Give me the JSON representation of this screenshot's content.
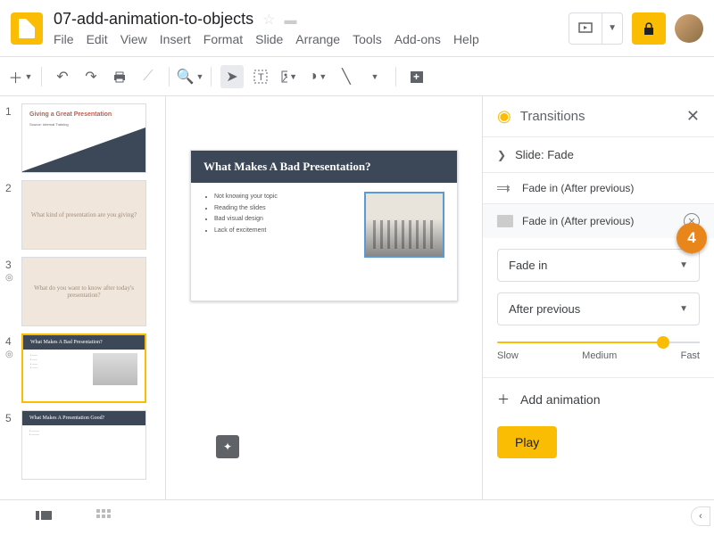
{
  "header": {
    "title": "07-add-animation-to-objects",
    "menu": [
      "File",
      "Edit",
      "View",
      "Insert",
      "Format",
      "Slide",
      "Arrange",
      "Tools",
      "Add-ons",
      "Help"
    ]
  },
  "filmstrip": {
    "slides": [
      {
        "num": "1",
        "title": "Giving a Great Presentation",
        "sub": "Source: Internal Training"
      },
      {
        "num": "2",
        "text": "What kind of presentation are you giving?"
      },
      {
        "num": "3",
        "text": "What do you want to know after today's presentation?"
      },
      {
        "num": "4",
        "title": "What Makes A Bad Presentation?"
      },
      {
        "num": "5",
        "title": "What Makes A Presentation Good?"
      }
    ]
  },
  "canvas": {
    "title": "What Makes A Bad Presentation?",
    "bullets": [
      "Not knowing your topic",
      "Reading the slides",
      "Bad visual design",
      "Lack of excitement"
    ]
  },
  "panel": {
    "title": "Transitions",
    "slide_row": "Slide: Fade",
    "anims": [
      {
        "label": "Fade in  (After previous)"
      },
      {
        "label": "Fade in  (After previous)"
      }
    ],
    "type_select": "Fade in",
    "start_select": "After previous",
    "speed": {
      "slow": "Slow",
      "medium": "Medium",
      "fast": "Fast"
    },
    "add": "Add animation",
    "play": "Play"
  },
  "callout": "4"
}
